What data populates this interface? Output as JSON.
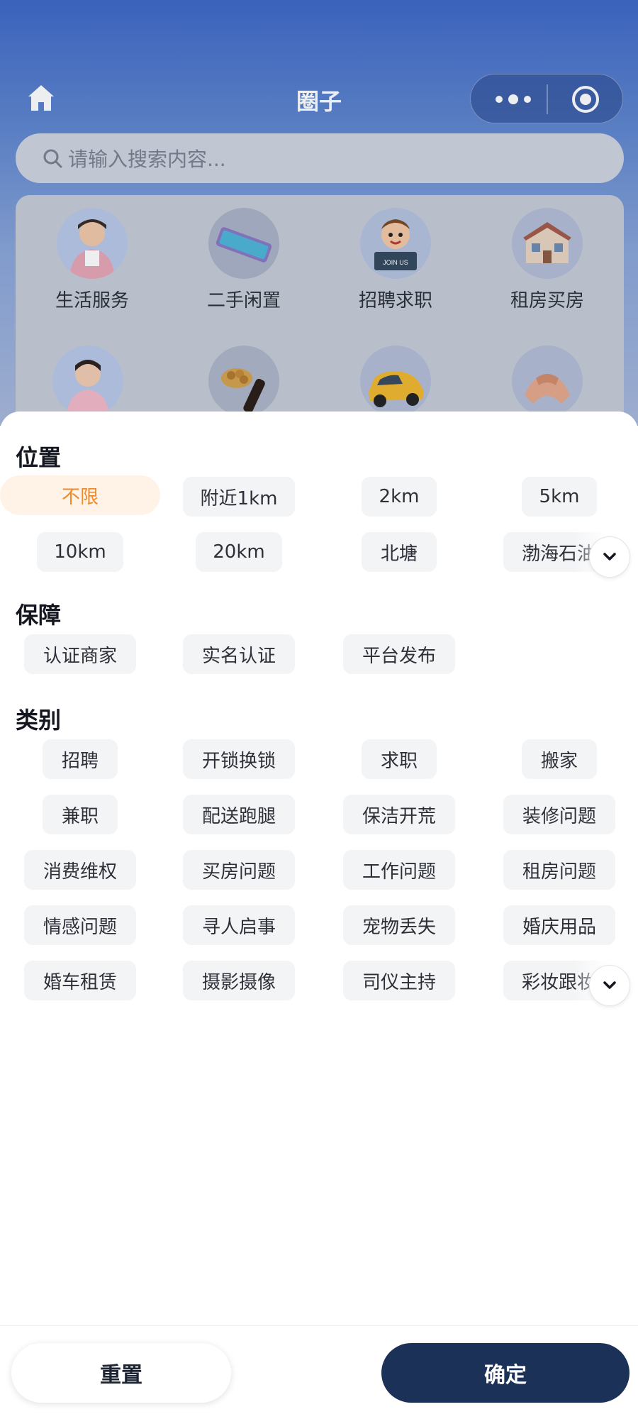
{
  "header": {
    "title": "圈子",
    "home_icon": "home-icon",
    "more_icon": "more-dots-icon",
    "target_icon": "record-target-icon"
  },
  "search": {
    "placeholder": "请输入搜索内容..."
  },
  "categories": [
    {
      "label": "生活服务",
      "icon": "housekeeper-avatar-icon"
    },
    {
      "label": "二手闲置",
      "icon": "smartphone-icon"
    },
    {
      "label": "招聘求职",
      "icon": "join-us-boy-icon"
    },
    {
      "label": "租房买房",
      "icon": "house-icon"
    },
    {
      "label": "",
      "icon": "woman-avatar-icon"
    },
    {
      "label": "",
      "icon": "nuts-wine-icon"
    },
    {
      "label": "",
      "icon": "car-icon"
    },
    {
      "label": "",
      "icon": "handshake-icon"
    }
  ],
  "filter": {
    "location": {
      "title": "位置",
      "selected": "不限",
      "options": [
        "不限",
        "附近1km",
        "2km",
        "5km",
        "10km",
        "20km",
        "北塘",
        "渤海石油"
      ]
    },
    "guarantee": {
      "title": "保障",
      "options": [
        "认证商家",
        "实名认证",
        "平台发布"
      ]
    },
    "category": {
      "title": "类别",
      "options": [
        "招聘",
        "开锁换锁",
        "求职",
        "搬家",
        "兼职",
        "配送跑腿",
        "保洁开荒",
        "装修问题",
        "消费维权",
        "买房问题",
        "工作问题",
        "租房问题",
        "情感问题",
        "寻人启事",
        "宠物丢失",
        "婚庆用品",
        "婚车租赁",
        "摄影摄像",
        "司仪主持",
        "彩妆跟妆"
      ]
    }
  },
  "footer": {
    "reset_label": "重置",
    "confirm_label": "确定"
  },
  "colors": {
    "accent": "#ef8a2a",
    "primary": "#1c3157",
    "header_gradient_top": "#3e68c6"
  }
}
